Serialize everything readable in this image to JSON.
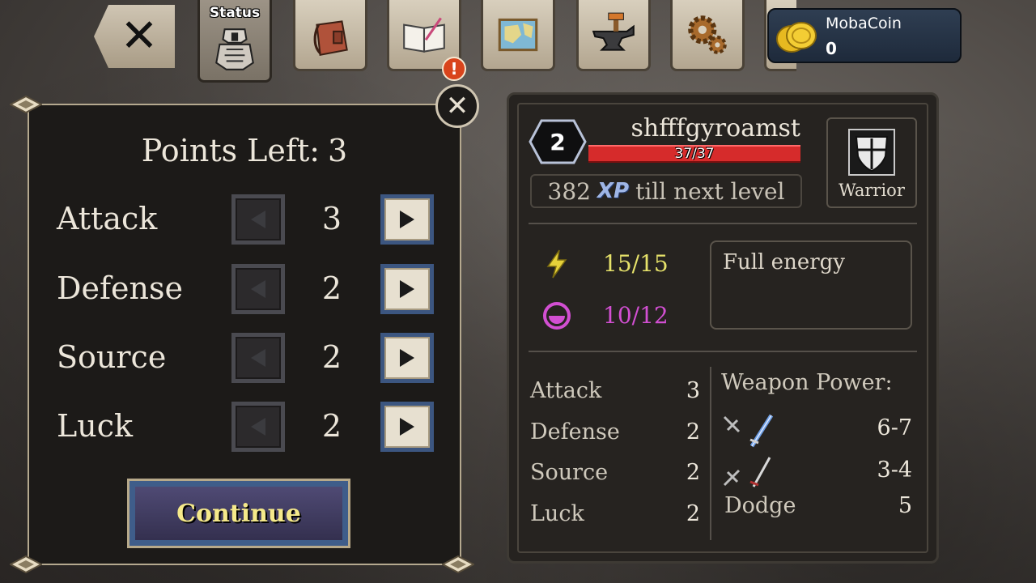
{
  "top_bar": {
    "tabs": [
      {
        "id": "status",
        "label": "Status",
        "icon": "armor-icon"
      },
      {
        "id": "inventory",
        "label": "",
        "icon": "bag-icon"
      },
      {
        "id": "journal",
        "label": "",
        "icon": "book-icon"
      },
      {
        "id": "map",
        "label": "",
        "icon": "map-icon"
      },
      {
        "id": "smithy",
        "label": "",
        "icon": "anvil-icon"
      },
      {
        "id": "settings",
        "label": "",
        "icon": "gear-icon"
      }
    ],
    "alert_badge": "!",
    "currency": {
      "name": "MobaCoin",
      "value": "0"
    }
  },
  "points_panel": {
    "points_left_label": "Points Left:",
    "points_left_value": "3",
    "stats": [
      {
        "name": "Attack",
        "value": "3"
      },
      {
        "name": "Defense",
        "value": "2"
      },
      {
        "name": "Source",
        "value": "2"
      },
      {
        "name": "Luck",
        "value": "2"
      }
    ],
    "continue_label": "Continue",
    "close_glyph": "✕"
  },
  "character": {
    "level": "2",
    "name": "shfffgyroamst",
    "hp_text": "37/37",
    "xp_remaining": "382",
    "xp_tag": "XP",
    "xp_suffix": "till next level",
    "class_name": "Warrior",
    "energy": "15/15",
    "energy_color": "#e6e26a",
    "source": "10/12",
    "source_color": "#d24fd2",
    "energy_status": "Full energy",
    "attributes": [
      {
        "name": "Attack",
        "value": "3"
      },
      {
        "name": "Defense",
        "value": "2"
      },
      {
        "name": "Source",
        "value": "2"
      },
      {
        "name": "Luck",
        "value": "2"
      }
    ],
    "weapon_power_label": "Weapon Power:",
    "weapons": [
      {
        "icon": "magic-sword-icon",
        "value": "6-7"
      },
      {
        "icon": "sword-icon",
        "value": "3-4"
      }
    ],
    "dodge_label": "Dodge",
    "dodge_value": "5"
  }
}
